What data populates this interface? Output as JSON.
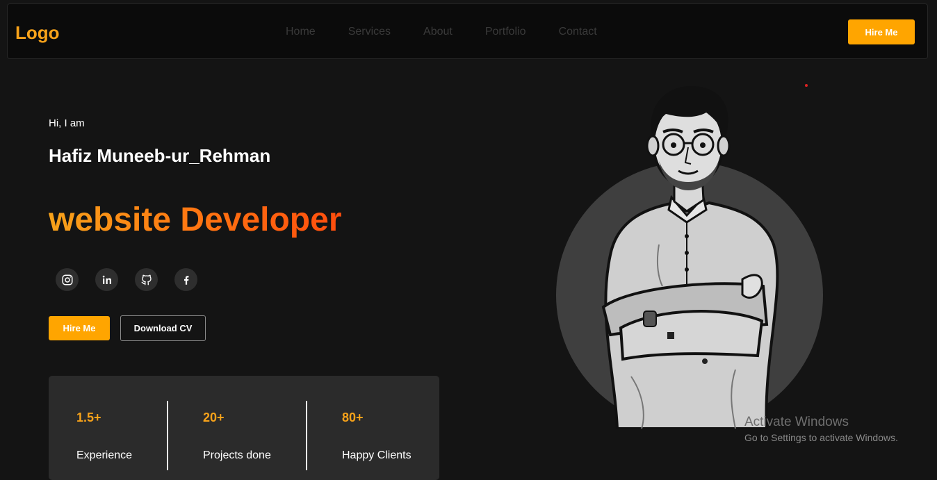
{
  "nav": {
    "logo": "Logo",
    "links": [
      "Home",
      "Services",
      "About",
      "Portfolio",
      "Contact"
    ],
    "hire_label": "Hire Me"
  },
  "hero": {
    "greeting": "Hi, I am",
    "name": "Hafiz Muneeb-ur_Rehman",
    "role": "website Developer",
    "socials": [
      "instagram-icon",
      "linkedin-icon",
      "github-icon",
      "facebook-icon"
    ],
    "hire_label": "Hire Me",
    "cv_label": "Download CV"
  },
  "stats": [
    {
      "value": "1.5+",
      "label": "Experience"
    },
    {
      "value": "20+",
      "label": "Projects done"
    },
    {
      "value": "80+",
      "label": "Happy Clients"
    }
  ],
  "watermark": {
    "title": "Activate Windows",
    "subtitle": "Go to Settings to activate Windows."
  },
  "colors": {
    "accent": "#ffa500",
    "role_gradient_start": "#f7a21a",
    "role_gradient_end": "#ff4d0d",
    "background": "#141414"
  }
}
